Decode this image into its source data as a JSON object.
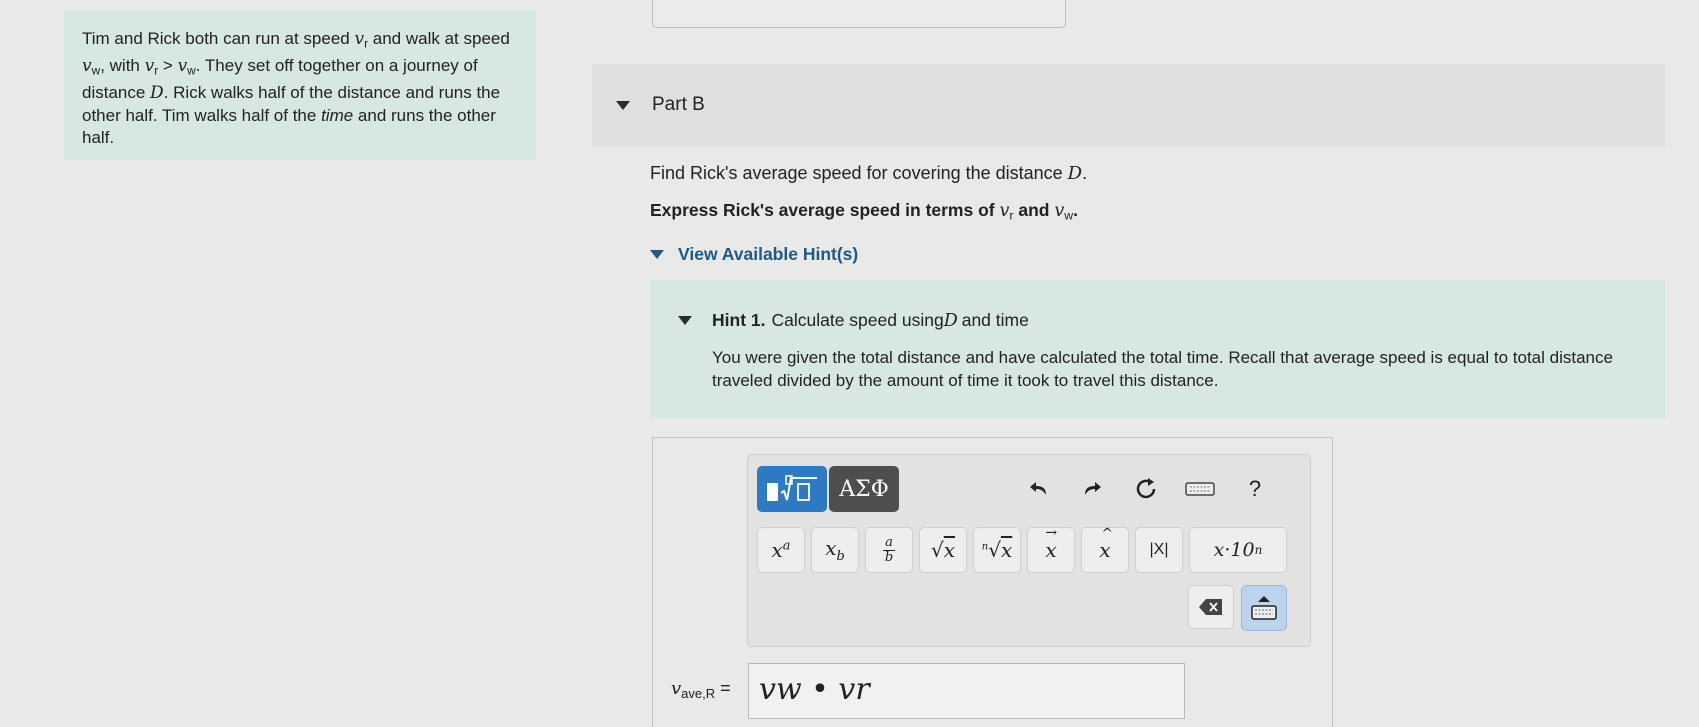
{
  "problem": {
    "t1": "Tim and Rick both can run at speed ",
    "vr": "v",
    "r_sub": "r",
    "t2": " and walk at speed ",
    "vw": "v",
    "w_sub": "w",
    "t3": ", with ",
    "ineq": " > ",
    "t4": ". They set off together on a journey of distance ",
    "D": "D",
    "t5": ". Rick walks half of the distance and runs the other half. Tim walks half of the ",
    "time": "time",
    "t6": " and runs the other half."
  },
  "part": {
    "title": "Part B"
  },
  "question": {
    "line1_pre": "Find Rick's average speed for covering the distance ",
    "line1_D": "D",
    "line1_post": ".",
    "line2_pre": "Express Rick's average speed in terms of ",
    "line2_and": " and ",
    "line2_post": "."
  },
  "hints": {
    "toggle_label": "View Available Hint(s)",
    "hint1_label": "Hint 1.",
    "hint1_title_pre": "Calculate speed using ",
    "hint1_title_D": "D",
    "hint1_title_post": " and time",
    "hint1_body": "You were given the total distance and have calculated the total time. Recall that average speed is equal to total distance traveled divided by the amount of time it took to travel this distance."
  },
  "toolbar": {
    "greek_tab": "ΑΣΦ",
    "help": "?",
    "abs": "|X|",
    "sci_base": "x·10",
    "sci_exp": "n"
  },
  "answer": {
    "label_v": "v",
    "label_sub": "ave,R",
    "label_eq": " =",
    "input_value": "vw • vr"
  }
}
